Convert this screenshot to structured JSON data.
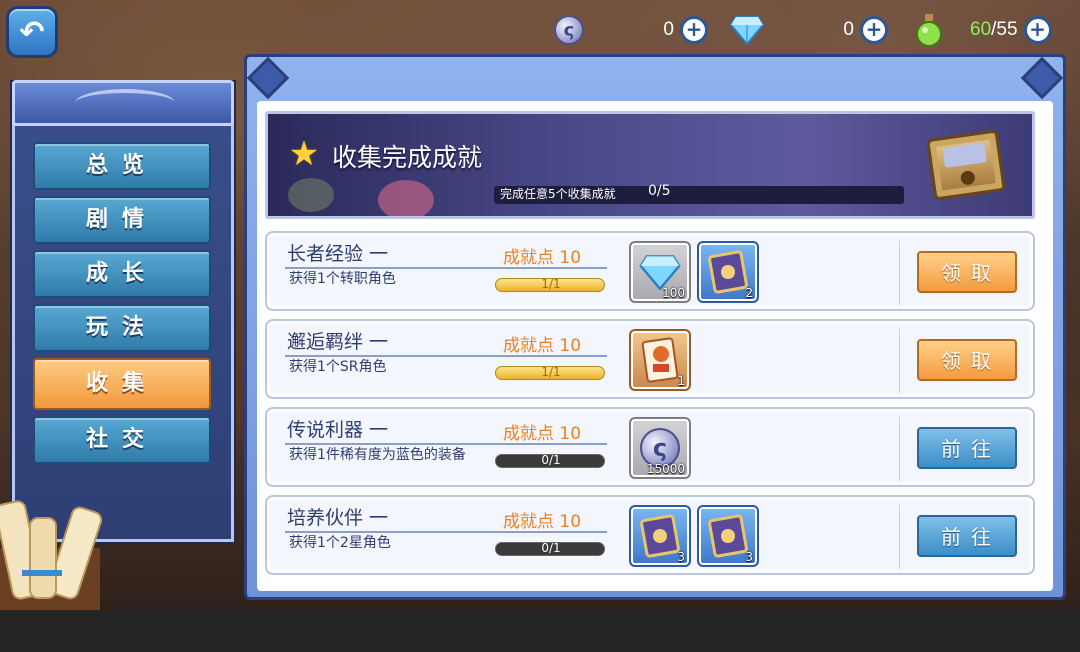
{
  "resources": [
    {
      "icon": "silver-coin-icon",
      "value": "0"
    },
    {
      "icon": "diamond-icon",
      "value": "0"
    },
    {
      "icon": "stamina-potion-icon",
      "current": "60",
      "max": "/55"
    }
  ],
  "sidebar": {
    "items": [
      {
        "label": "总览",
        "active": false
      },
      {
        "label": "剧情",
        "active": false
      },
      {
        "label": "成长",
        "active": false
      },
      {
        "label": "玩法",
        "active": false
      },
      {
        "label": "收集",
        "active": true
      },
      {
        "label": "社交",
        "active": false
      }
    ]
  },
  "banner": {
    "title": "收集完成成就",
    "progress_text": "完成任意5个收集成就",
    "progress_count": "0/5"
  },
  "achievements": [
    {
      "title": "长者经验 一",
      "points": "成就点 10",
      "desc": "获得1个转职角色",
      "progress": "1/1",
      "done": true,
      "rewards": [
        {
          "type": "diamond",
          "icon": "diamond-icon",
          "count": "100"
        },
        {
          "type": "book",
          "icon": "book-icon",
          "count": "2"
        }
      ],
      "action": "领取"
    },
    {
      "title": "邂逅羁绊 一",
      "points": "成就点 10",
      "desc": "获得1个SR角色",
      "progress": "1/1",
      "done": true,
      "rewards": [
        {
          "type": "card",
          "icon": "character-card-icon",
          "count": "1"
        }
      ],
      "action": "领取"
    },
    {
      "title": "传说利器 一",
      "points": "成就点 10",
      "desc": "获得1件稀有度为蓝色的装备",
      "progress": "0/1",
      "done": false,
      "rewards": [
        {
          "type": "coin",
          "icon": "silver-coin-icon",
          "count": "15000"
        }
      ],
      "action": "前往"
    },
    {
      "title": "培养伙伴 一",
      "points": "成就点 10",
      "desc": "获得1个2星角色",
      "progress": "0/1",
      "done": false,
      "rewards": [
        {
          "type": "book",
          "icon": "book-icon",
          "count": "3"
        },
        {
          "type": "book",
          "icon": "book-icon",
          "count": "3"
        }
      ],
      "action": "前往"
    }
  ]
}
